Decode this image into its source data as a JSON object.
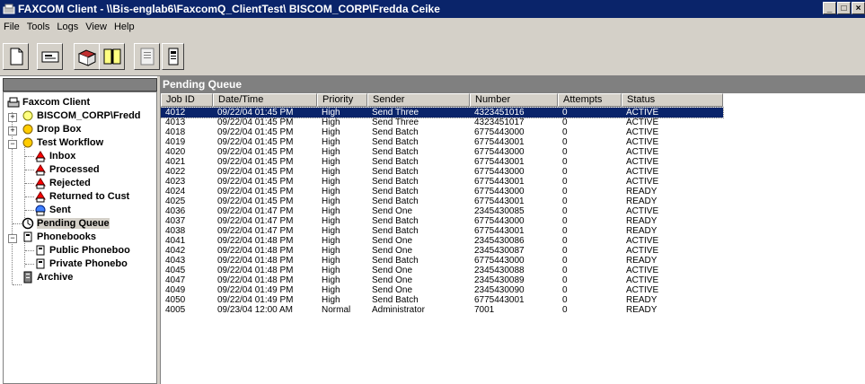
{
  "window": {
    "title": "FAXCOM Client  - \\\\Bis-englab6\\FaxcomQ_ClientTest\\ BISCOM_CORP\\Fredda Ceike",
    "controls": [
      "_",
      "□",
      "×"
    ]
  },
  "menu": [
    "File",
    "Tools",
    "Logs",
    "View",
    "Help"
  ],
  "toolbar": {
    "buttons": [
      "new-fax-icon",
      "cover-page-icon",
      "address-book-icon",
      "logs-icon",
      "fax-preview-icon",
      "phonebook-icon"
    ]
  },
  "tree": {
    "root": "Faxcom Client",
    "biscom": "BISCOM_CORP\\Fredd",
    "dropbox": "Drop Box",
    "workflow": "Test Workflow",
    "inbox": "Inbox",
    "processed": "Processed",
    "rejected": "Rejected",
    "returned": "Returned to Cust",
    "sent": "Sent",
    "pending": "Pending Queue",
    "phonebooks": "Phonebooks",
    "public_pb": "Public Phoneboo",
    "private_pb": "Private Phonebo",
    "archive": "Archive"
  },
  "queue": {
    "title": "Pending Queue",
    "columns": [
      "Job ID",
      "Date/Time",
      "Priority",
      "Sender",
      "Number",
      "Attempts",
      "Status"
    ],
    "rows": [
      [
        "4012",
        "09/22/04 01:45 PM",
        "High",
        "Send Three",
        "4323451016",
        "0",
        "ACTIVE"
      ],
      [
        "4013",
        "09/22/04 01:45 PM",
        "High",
        "Send Three",
        "4323451017",
        "0",
        "ACTIVE"
      ],
      [
        "4018",
        "09/22/04 01:45 PM",
        "High",
        "Send Batch",
        "6775443000",
        "0",
        "ACTIVE"
      ],
      [
        "4019",
        "09/22/04 01:45 PM",
        "High",
        "Send Batch",
        "6775443001",
        "0",
        "ACTIVE"
      ],
      [
        "4020",
        "09/22/04 01:45 PM",
        "High",
        "Send Batch",
        "6775443000",
        "0",
        "ACTIVE"
      ],
      [
        "4021",
        "09/22/04 01:45 PM",
        "High",
        "Send Batch",
        "6775443001",
        "0",
        "ACTIVE"
      ],
      [
        "4022",
        "09/22/04 01:45 PM",
        "High",
        "Send Batch",
        "6775443000",
        "0",
        "ACTIVE"
      ],
      [
        "4023",
        "09/22/04 01:45 PM",
        "High",
        "Send Batch",
        "6775443001",
        "0",
        "ACTIVE"
      ],
      [
        "4024",
        "09/22/04 01:45 PM",
        "High",
        "Send Batch",
        "6775443000",
        "0",
        "READY"
      ],
      [
        "4025",
        "09/22/04 01:45 PM",
        "High",
        "Send Batch",
        "6775443001",
        "0",
        "READY"
      ],
      [
        "4036",
        "09/22/04 01:47 PM",
        "High",
        "Send One",
        "2345430085",
        "0",
        "ACTIVE"
      ],
      [
        "4037",
        "09/22/04 01:47 PM",
        "High",
        "Send Batch",
        "6775443000",
        "0",
        "READY"
      ],
      [
        "4038",
        "09/22/04 01:47 PM",
        "High",
        "Send Batch",
        "6775443001",
        "0",
        "READY"
      ],
      [
        "4041",
        "09/22/04 01:48 PM",
        "High",
        "Send One",
        "2345430086",
        "0",
        "ACTIVE"
      ],
      [
        "4042",
        "09/22/04 01:48 PM",
        "High",
        "Send One",
        "2345430087",
        "0",
        "ACTIVE"
      ],
      [
        "4043",
        "09/22/04 01:48 PM",
        "High",
        "Send Batch",
        "6775443000",
        "0",
        "READY"
      ],
      [
        "4045",
        "09/22/04 01:48 PM",
        "High",
        "Send One",
        "2345430088",
        "0",
        "ACTIVE"
      ],
      [
        "4047",
        "09/22/04 01:48 PM",
        "High",
        "Send One",
        "2345430089",
        "0",
        "ACTIVE"
      ],
      [
        "4049",
        "09/22/04 01:49 PM",
        "High",
        "Send One",
        "2345430090",
        "0",
        "ACTIVE"
      ],
      [
        "4050",
        "09/22/04 01:49 PM",
        "High",
        "Send Batch",
        "6775443001",
        "0",
        "READY"
      ],
      [
        "4005",
        "09/23/04 12:00 AM",
        "Normal",
        "Administrator",
        "7001",
        "0",
        "READY"
      ]
    ],
    "selected_row": 0
  },
  "colors": {
    "titlebar": "#0a246a",
    "chrome": "#d4d0c8",
    "header_gray": "#808080",
    "selection": "#0a246a"
  }
}
